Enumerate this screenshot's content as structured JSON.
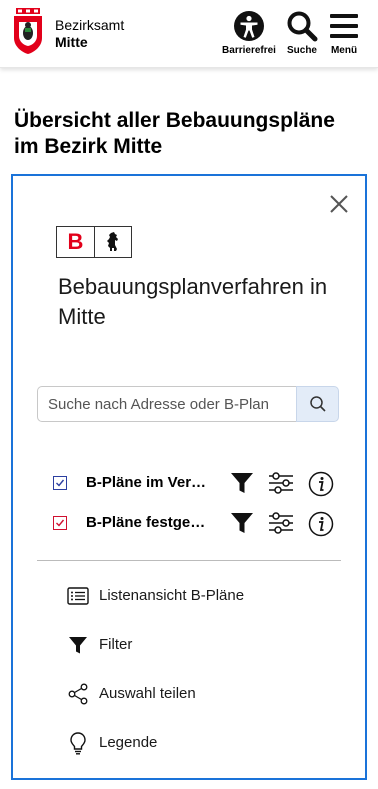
{
  "header": {
    "brand_line1": "Bezirksamt",
    "brand_line2": "Mitte",
    "buttons": [
      {
        "label": "Barrierefrei",
        "icon": "accessibility-icon"
      },
      {
        "label": "Suche",
        "icon": "search-icon"
      },
      {
        "label": "Menü",
        "icon": "hamburger-menu-icon"
      }
    ]
  },
  "page": {
    "title": "Übersicht aller Bebauungspläne im Bezirk Mitte"
  },
  "panel": {
    "logo_letter": "B",
    "title": "Bebauungsplanverfahren in Mitte",
    "search": {
      "placeholder": "Suche nach Adresse oder B-Plan",
      "value": ""
    },
    "layers": [
      {
        "label": "B-Pläne im Verfahren",
        "checked": true,
        "color": "#2c3fa0"
      },
      {
        "label": "B-Pläne festgesetzt",
        "checked": true,
        "color": "#d01030"
      }
    ],
    "menu": [
      {
        "label": "Listenansicht B-Pläne",
        "icon": "list-icon"
      },
      {
        "label": "Filter",
        "icon": "filter-icon"
      },
      {
        "label": "Auswahl teilen",
        "icon": "share-icon"
      },
      {
        "label": "Legende",
        "icon": "lightbulb-icon"
      }
    ]
  },
  "colors": {
    "accent": "#1a73d9",
    "red": "#e2001a"
  }
}
